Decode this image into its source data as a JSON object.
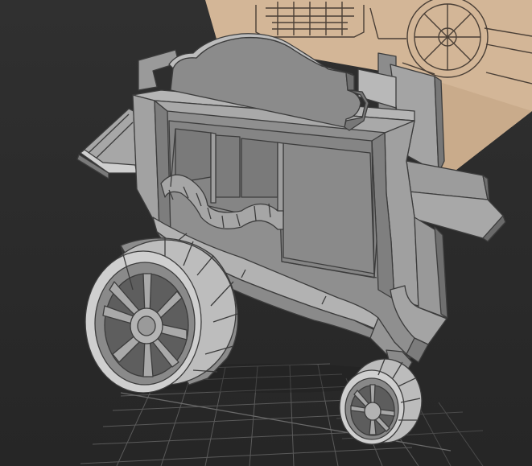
{
  "viewport": {
    "kind": "3d-viewport",
    "shading": "flat-shaded-with-edges",
    "background_color": "#2c2c2c",
    "grid_color": "#5e5e5e"
  },
  "reference_image": {
    "content": "sketch-of-carriage",
    "paper_color": "#d3b697",
    "line_color": "#4a3f36"
  },
  "model": {
    "content": "low-poly-stagecoach",
    "parts": [
      "cabin",
      "roof-crest",
      "rear-rack",
      "front-footboard",
      "drawbar",
      "large-wheel",
      "small-wheel"
    ],
    "face_color": "#8e8e8e",
    "edge_color": "#3c3c3c"
  }
}
